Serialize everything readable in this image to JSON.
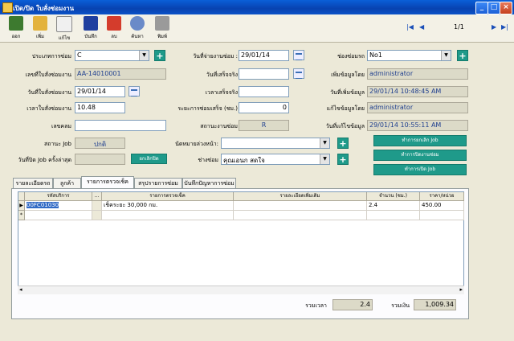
{
  "window": {
    "title": "เปิด/ปิด ใบสั่งซ่อมงาน"
  },
  "toolbar": {
    "buttons": [
      {
        "label": "ออก",
        "color": "#3d7a2f"
      },
      {
        "label": "เพิ่ม",
        "color": "#e3b23c"
      },
      {
        "label": "แก้ไข",
        "color": "#f0f0f0"
      },
      {
        "label": "บันทึก",
        "color": "#1f3f9f"
      },
      {
        "label": "ลบ",
        "color": "#d43c2c"
      },
      {
        "label": "ค้นหา",
        "color": "#6a8ac8"
      },
      {
        "label": "พิมพ์",
        "color": "#9a9a9a"
      }
    ],
    "page_indicator": "1/1"
  },
  "form": {
    "repair_type": {
      "label": "ประเภทการซ่อม",
      "value": "C"
    },
    "doc_no": {
      "label": "เลขที่ใบสั่งซ่อมงาน",
      "value": "AA-14010001"
    },
    "doc_date": {
      "label": "วันที่ใบสั่งซ่อมงาน",
      "value": "29/01/14"
    },
    "doc_time": {
      "label": "เวลาใบสั่งซ่อมงาน",
      "value": "10.48"
    },
    "km": {
      "label": "เลขคลม",
      "value": ""
    },
    "job_status": {
      "label": "สถานะ Job",
      "value": "ปกติ"
    },
    "close_date": {
      "label": "วันที่ปิด Job ครั้งล่าสุด",
      "value": "",
      "button": "ยกเลิกปิด"
    },
    "receive_date": {
      "label": "วันที่จ่ายงานซ่อม :",
      "value": "29/01/14"
    },
    "finish_date": {
      "label": "วันที่เสร็จจริง",
      "value": ""
    },
    "finish_time": {
      "label": "เวลาเสร็จจริง",
      "value": ""
    },
    "duration": {
      "label": "ระยะการซ่อมเสร็จ (ชม.)",
      "value": "0"
    },
    "work_status": {
      "label": "สถานะงานซ่อม",
      "value": "R"
    },
    "next_appointment": {
      "label": "นัดหมายล่วงหน้า:",
      "value": ""
    },
    "mechanic": {
      "label": "ช่างซ่อม",
      "value": "คุณเอนก สดใจ"
    },
    "repair_channel": {
      "label": "ช่องซ่อมรถ",
      "value": "No1"
    },
    "created_by": {
      "label": "เพิ่มข้อมูลโดย",
      "value": "administrator"
    },
    "created_at": {
      "label": "วันที่เพิ่มข้อมูล",
      "value": "29/01/14 10:48:45 AM"
    },
    "modified_by": {
      "label": "แก้ไขข้อมูลโดย",
      "value": "administrator"
    },
    "modified_at": {
      "label": "วันที่แก้ไขข้อมูล",
      "value": "29/01/14 10:55:11 AM"
    }
  },
  "actions": [
    "ทำการยกเลิก Job",
    "ทำการปิดงานซ่อม",
    "ทำการเปิด Job"
  ],
  "tabs": [
    "รายละเอียดรถ",
    "ลูกค้า",
    "รายการตรวจเช็ค",
    "สรุปรายการซ่อม",
    "บันทึกปัญหาการซ่อม"
  ],
  "grid": {
    "columns": [
      "รหัสบริการ",
      "...",
      "รายการตรวจเช็ค",
      "รายละเอียดเพิ่มเติม",
      "จำนวน (ชม.)",
      "ราคา/หน่วย"
    ],
    "rows": [
      {
        "code": "00FC01030",
        "item": "เช็คระยะ 30,000 กม.",
        "detail": "",
        "hours": "2.4",
        "price": "450.00"
      }
    ]
  },
  "totals": {
    "time_label": "รวมเวลา",
    "time": "2.4",
    "sum_label": "รวมเงิน",
    "sum": "1,009.34"
  }
}
